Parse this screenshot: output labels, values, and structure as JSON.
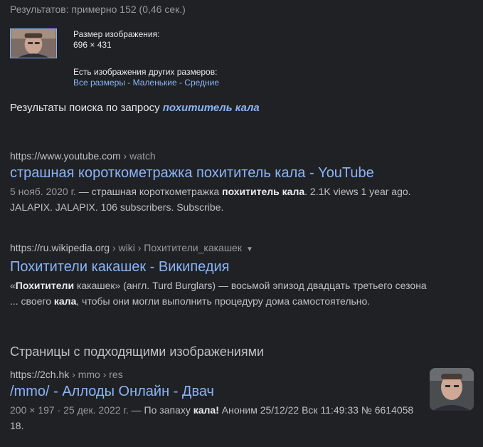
{
  "stats": "Результатов: примерно 152 (0,46 сек.)",
  "image_info": {
    "size_label": "Размер изображения:",
    "size_value": "696 × 431",
    "other_sizes_label": "Есть изображения других размеров:",
    "link_all": "Все размеры",
    "link_small": "Маленькие",
    "link_medium": "Средние",
    "sep": " - "
  },
  "best_guess": {
    "prefix": "Результаты поиска по запросу",
    "query": "похититель кала"
  },
  "results": [
    {
      "host": "https://www.youtube.com",
      "crumbs": " › watch",
      "title": "страшная короткометражка похититель кала - YouTube",
      "date": "5 нояб. 2020 г.",
      "s1": " — страшная короткометражка ",
      "b1": "похититель кала",
      "s2": ". 2.1K views 1 year ago. JALAPIX. JALAPIX. 106 subscribers. Subscribe."
    },
    {
      "host": "https://ru.wikipedia.org",
      "crumbs": " › wiki › Похитители_какашек",
      "title": "Похитители какашек - Википедия",
      "s0": "«",
      "b0": "Похитители",
      "s1": " какашек» (англ. Turd Burglars) — восьмой эпизод двадцать третьего сезона ... своего ",
      "b1": "кала",
      "s2": ", чтобы они могли выполнить процедуру дома самостоятельно."
    }
  ],
  "pages_heading": "Страницы с подходящими изображениями",
  "page_result": {
    "host": "https://2ch.hk",
    "crumbs": " › mmo › res",
    "title": "/mmo/ - Аллоды Онлайн - Двач",
    "meta": "200 × 197 · 25 дек. 2022 г.",
    "s1": " — По запаху ",
    "b1": "кала!",
    "s2": " Аноним 25/12/22 Вск 11:49:33 № 6614058 18."
  }
}
